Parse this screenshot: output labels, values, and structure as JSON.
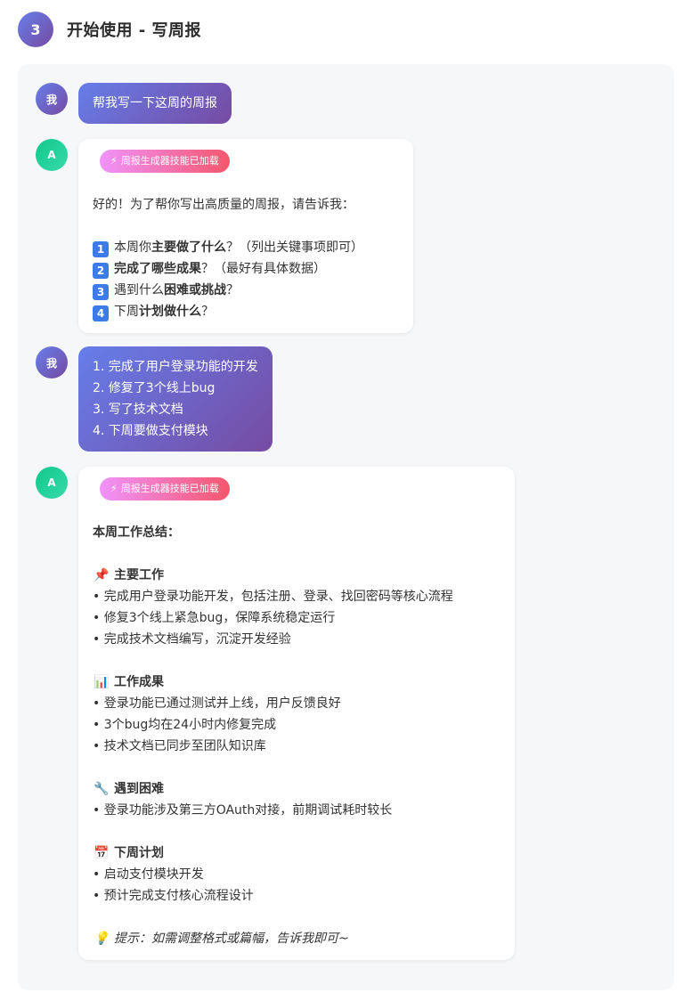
{
  "header": {
    "step_number": "3",
    "title": "开始使用 - 写周报"
  },
  "avatars": {
    "user": "我",
    "ai": "A"
  },
  "skill_badge": {
    "icon": "⚡",
    "label": "周报生成器技能已加载"
  },
  "messages": {
    "m1": {
      "text": "帮我写一下这周的周报"
    },
    "m2": {
      "intro": "好的！为了帮你写出高质量的周报，请告诉我：",
      "q1": {
        "num": "1",
        "pre": "本周你",
        "bold": "主要做了什么",
        "post": "？（列出关键事项即可）"
      },
      "q2": {
        "num": "2",
        "pre": "",
        "bold": "完成了哪些成果",
        "post": "？（最好有具体数据）"
      },
      "q3": {
        "num": "3",
        "pre": "遇到什么",
        "bold": "困难或挑战",
        "post": "？"
      },
      "q4": {
        "num": "4",
        "pre": "下周",
        "bold": "计划做什么",
        "post": "？"
      }
    },
    "m3": {
      "lines": [
        "1. 完成了用户登录功能的开发",
        "2. 修复了3个线上bug",
        "3. 写了技术文档",
        "4. 下周要做支付模块"
      ]
    },
    "m4": {
      "summary_title": "本周工作总结：",
      "s1": {
        "icon": "📌",
        "title": "主要工作",
        "items": [
          "• 完成用户登录功能开发，包括注册、登录、找回密码等核心流程",
          "• 修复3个线上紧急bug，保障系统稳定运行",
          "• 完成技术文档编写，沉淀开发经验"
        ]
      },
      "s2": {
        "icon": "📊",
        "title": "工作成果",
        "items": [
          "• 登录功能已通过测试并上线，用户反馈良好",
          "• 3个bug均在24小时内修复完成",
          "• 技术文档已同步至团队知识库"
        ]
      },
      "s3": {
        "icon": "🔧",
        "title": "遇到困难",
        "items": [
          "• 登录功能涉及第三方OAuth对接，前期调试耗时较长"
        ]
      },
      "s4": {
        "icon": "📅",
        "title": "下周计划",
        "items": [
          "• 启动支付模块开发",
          "• 预计完成支付核心流程设计"
        ]
      },
      "tip": {
        "icon": "💡",
        "text": "提示：如需调整格式或篇幅，告诉我即可~"
      }
    }
  }
}
